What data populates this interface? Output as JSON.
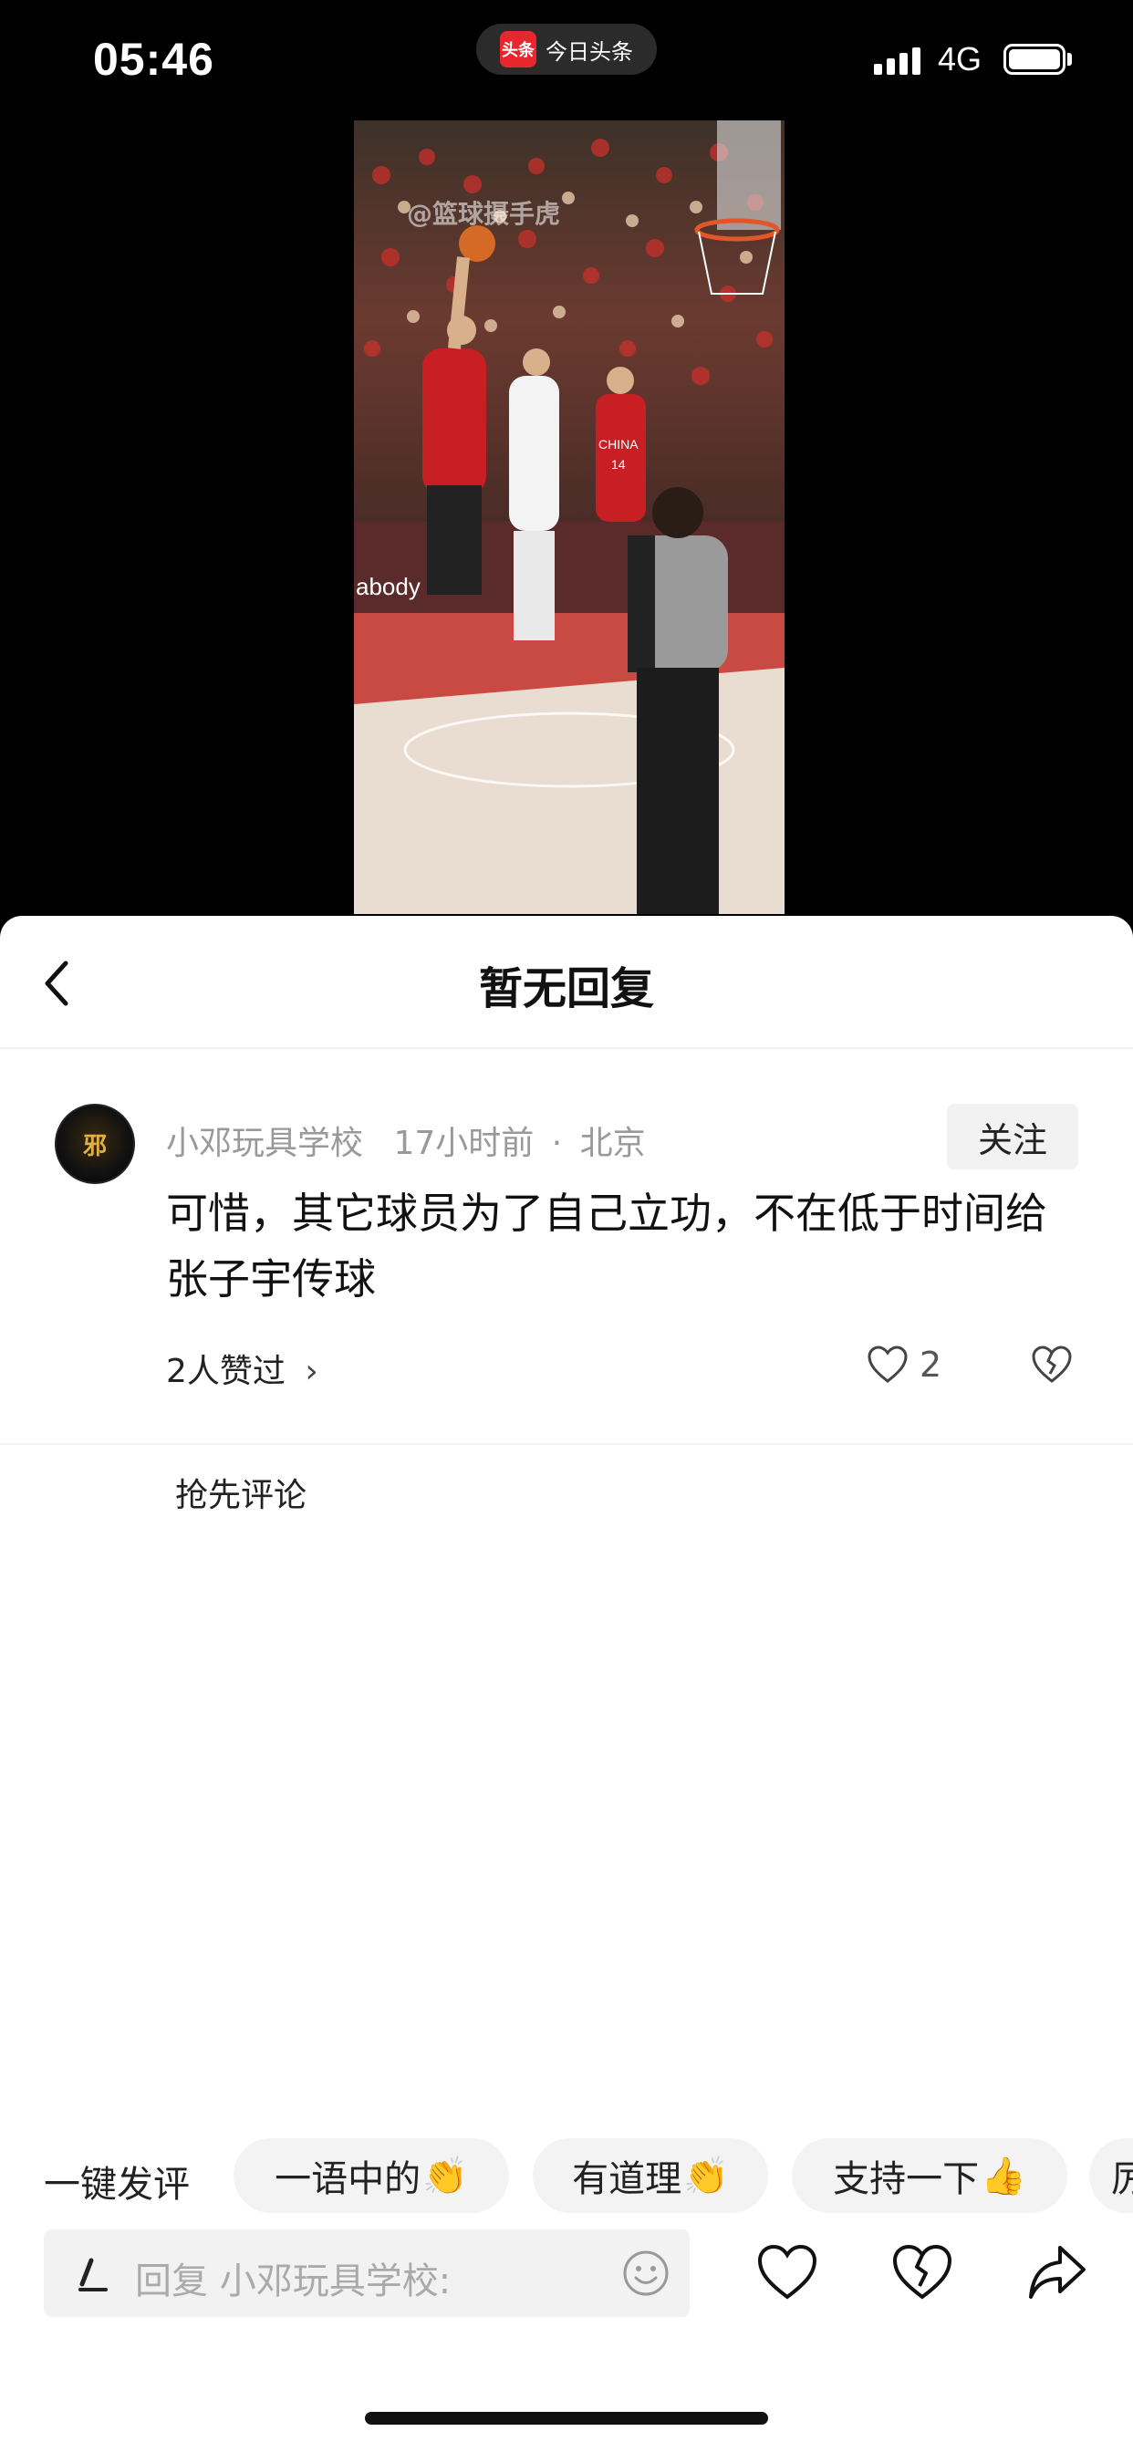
{
  "status_bar": {
    "time": "05:46",
    "app_pill": {
      "logo": "头条",
      "label": "今日头条"
    },
    "network": "4G"
  },
  "video": {
    "watermark": "@篮球摄手虎",
    "court_text": "abody",
    "jersey_text": "CHINA",
    "jersey_number": "14"
  },
  "sheet": {
    "title": "暂无回复",
    "comment": {
      "avatar_text": "邪",
      "author": "小邓玩具学校",
      "time": "17小时前",
      "separator": "·",
      "location": "北京",
      "follow_label": "关注",
      "text": "可惜，其它球员为了自己立功，不在低于时间给张子宇传球",
      "likers": "2人赞过",
      "likers_chevron": "›",
      "like_count": "2"
    },
    "first_comment_label": "抢先评论"
  },
  "quick_replies": {
    "label": "一键发评",
    "chips": [
      {
        "text": "一语中的",
        "emoji": "👏"
      },
      {
        "text": "有道理",
        "emoji": "👏"
      },
      {
        "text": "支持一下",
        "emoji": "👍"
      },
      {
        "text": "厉",
        "emoji": ""
      }
    ]
  },
  "bottom_bar": {
    "reply_placeholder": "回复 小邓玩具学校:"
  },
  "icons": {
    "back": "chevron-left-icon",
    "like": "heart-icon",
    "dislike": "broken-heart-icon",
    "share": "share-arrow-icon",
    "emoji": "smiley-icon",
    "pen": "pen-icon"
  }
}
